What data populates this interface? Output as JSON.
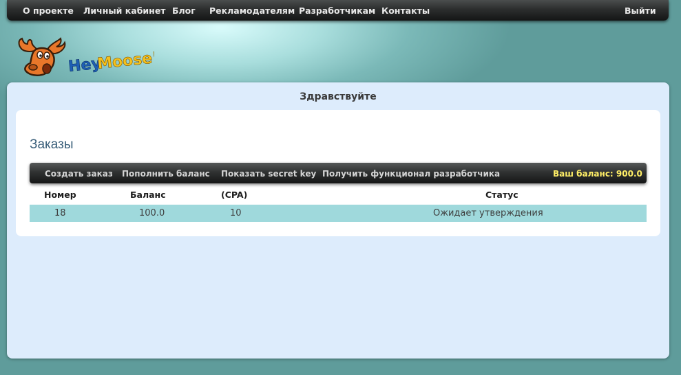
{
  "nav": {
    "items": [
      "О проекте",
      "Личный кабинет",
      "Блог",
      "Рекламодателям",
      "Разработчикам",
      "Контакты"
    ],
    "logout": "Выйти"
  },
  "logo": {
    "text": "HeyMoose!",
    "colors": {
      "moose": "#e8772a",
      "text_blue": "#1e5fb4",
      "text_yellow": "#f6c21c"
    }
  },
  "greeting": "Здравствуйте",
  "orders": {
    "title": "Заказы",
    "toolbar": {
      "items": [
        "Создать заказ",
        "Пополнить баланс",
        "Показать secret key",
        "Получить функционал разработчика"
      ],
      "balance": "Ваш баланс: 900.0"
    },
    "columns": [
      "Номер",
      "Баланс",
      "(CPA)",
      "Статус"
    ],
    "rows": [
      {
        "number": "18",
        "balance": "100.0",
        "cpa": "10",
        "status": "Ожидает утверждения"
      }
    ]
  }
}
